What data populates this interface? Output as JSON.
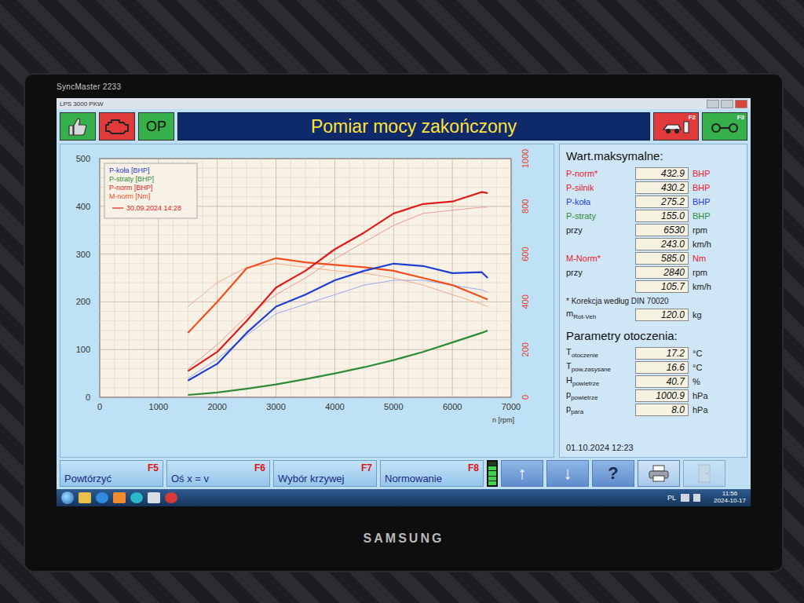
{
  "device": {
    "model": "SyncMaster 2233",
    "brand": "SAMSUNG"
  },
  "window": {
    "title": "LPS 3000 PKW"
  },
  "header": {
    "op_label": "OP",
    "title": "Pomiar mocy zakończony",
    "f2": "F2",
    "f3": "F3"
  },
  "chart": {
    "y_ticks": [
      "0",
      "100",
      "200",
      "300",
      "400",
      "500"
    ],
    "y2_ticks": [
      "0",
      "200",
      "400",
      "600",
      "800",
      "1000"
    ],
    "x_ticks": [
      "0",
      "1000",
      "2000",
      "3000",
      "4000",
      "5000",
      "6000",
      "7000"
    ],
    "x_label": "n [rpm]",
    "legend": [
      {
        "label": "P-koła [BHP]",
        "color": "#1f3fd0"
      },
      {
        "label": "P-straty [BHP]",
        "color": "#2e8b3a"
      },
      {
        "label": "P-norm [BHP]",
        "color": "#e01b1b"
      },
      {
        "label": "M-norm [Nm]",
        "color": "#f0501e"
      }
    ],
    "date_legend": {
      "label": "30.09.2024 14:28",
      "color": "#e01b1b"
    },
    "x": [
      1500,
      2000,
      2500,
      3000,
      3500,
      4000,
      4500,
      5000,
      5500,
      6000,
      6500,
      6600
    ],
    "series": [
      {
        "name": "P-norm ref",
        "axis": "left",
        "reference": true,
        "color": "#f08a8a",
        "values": [
          60,
          110,
          170,
          215,
          250,
          290,
          325,
          360,
          385,
          392,
          398,
          398
        ]
      },
      {
        "name": "P-koła ref",
        "axis": "left",
        "reference": true,
        "color": "#8c9cf0",
        "values": [
          40,
          80,
          130,
          175,
          195,
          215,
          235,
          245,
          245,
          235,
          225,
          220
        ]
      },
      {
        "name": "M-norm ref",
        "axis": "right",
        "reference": true,
        "color": "#f5a07a",
        "values": [
          380,
          480,
          545,
          560,
          545,
          530,
          520,
          500,
          470,
          430,
          390,
          380
        ]
      },
      {
        "name": "P-straty",
        "axis": "left",
        "reference": false,
        "color": "#2e8b3a",
        "values": [
          5,
          10,
          18,
          27,
          38,
          50,
          63,
          78,
          95,
          115,
          135,
          140
        ]
      },
      {
        "name": "M-norm",
        "axis": "right",
        "reference": false,
        "color": "#f0501e",
        "values": [
          270,
          400,
          540,
          583,
          565,
          555,
          545,
          530,
          500,
          470,
          420,
          410
        ]
      },
      {
        "name": "P-koła",
        "axis": "left",
        "reference": false,
        "color": "#1f3fd0",
        "values": [
          35,
          70,
          135,
          190,
          215,
          245,
          265,
          280,
          275,
          260,
          262,
          250
        ]
      },
      {
        "name": "P-norm",
        "axis": "left",
        "reference": false,
        "color": "#e01b1b",
        "values": [
          55,
          95,
          160,
          230,
          265,
          310,
          345,
          385,
          405,
          410,
          430,
          428
        ]
      }
    ]
  },
  "maxima": {
    "title": "Wart.maksymalne:",
    "rows": [
      {
        "label": "P-norm*",
        "value": "432.9",
        "unit": "BHP",
        "color": "#e8202a"
      },
      {
        "label": "P-silnik",
        "value": "430.2",
        "unit": "BHP",
        "color": "#e8202a"
      },
      {
        "label": "P-koła",
        "value": "275.2",
        "unit": "BHP",
        "color": "#1f3fd0"
      },
      {
        "label": "P-straty",
        "value": "155.0",
        "unit": "BHP",
        "color": "#2e8b3a"
      },
      {
        "label": "przy",
        "value": "6530",
        "unit": "rpm",
        "color": "#1a1a1a"
      },
      {
        "label": "",
        "value": "243.0",
        "unit": "km/h",
        "color": "#1a1a1a"
      },
      {
        "label": "M-Norm*",
        "value": "585.0",
        "unit": "Nm",
        "color": "#e8202a"
      },
      {
        "label": "przy",
        "value": "2840",
        "unit": "rpm",
        "color": "#1a1a1a"
      },
      {
        "label": "",
        "value": "105.7",
        "unit": "km/h",
        "color": "#1a1a1a"
      }
    ],
    "note": "* Korekcja według DIN 70020",
    "mass": {
      "label": "m",
      "sub": "Rot-Veh",
      "value": "120.0",
      "unit": "kg"
    }
  },
  "environment": {
    "title": "Parametry otoczenia:",
    "rows": [
      {
        "label": "T",
        "sub": "otoczenie",
        "value": "17.2",
        "unit": "°C"
      },
      {
        "label": "T",
        "sub": "pow.zasysane",
        "value": "16.6",
        "unit": "°C"
      },
      {
        "label": "H",
        "sub": "powietrze",
        "value": "40.7",
        "unit": "%"
      },
      {
        "label": "p",
        "sub": "powietrze",
        "value": "1000.9",
        "unit": "hPa"
      },
      {
        "label": "p",
        "sub": "para",
        "value": "8.0",
        "unit": "hPa"
      }
    ]
  },
  "timestamp": "01.10.2024 12:23",
  "fkeys": [
    {
      "label": "Powtórzyć",
      "key": "F5"
    },
    {
      "label": "Oś x = v",
      "key": "F6"
    },
    {
      "label": "Wybór krzywej",
      "key": "F7"
    },
    {
      "label": "Normowanie",
      "key": "F8"
    }
  ],
  "meter": {
    "level": 0.8
  },
  "tools": [
    {
      "kind": "arrow",
      "label": "↑",
      "disabled": false
    },
    {
      "kind": "arrow",
      "label": "↓",
      "disabled": false
    },
    {
      "kind": "help",
      "label": "?",
      "disabled": false
    },
    {
      "kind": "print",
      "label": "",
      "disabled": false
    },
    {
      "kind": "exit",
      "label": "",
      "disabled": true
    }
  ],
  "taskbar": {
    "lang": "PL",
    "time": "11:56",
    "date": "2024-10-17"
  }
}
